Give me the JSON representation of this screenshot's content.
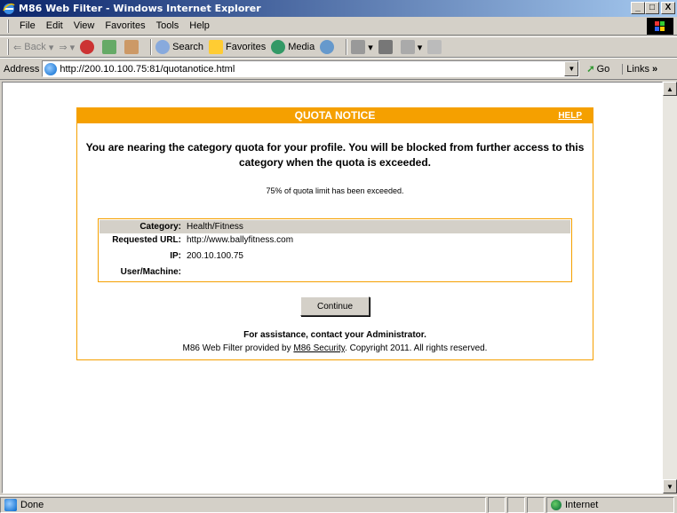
{
  "window": {
    "title": "M86 Web Filter - Windows Internet Explorer",
    "minimize": "_",
    "maximize": "□",
    "close": "X"
  },
  "menu": [
    "File",
    "Edit",
    "View",
    "Favorites",
    "Tools",
    "Help"
  ],
  "toolbar": {
    "back": "Back",
    "search": "Search",
    "favorites": "Favorites",
    "media": "Media"
  },
  "address": {
    "label": "Address",
    "url": "http://200.10.100.75:81/quotanotice.html",
    "go": "Go",
    "links": "Links"
  },
  "notice": {
    "title": "QUOTA NOTICE",
    "help": "HELP",
    "message": "You are nearing the category quota for your profile. You will be blocked from further access to this category when the quota is exceeded.",
    "percent_text": "75% of quota limit has been exceeded.",
    "details": [
      {
        "key": "Category:",
        "value": "Health/Fitness"
      },
      {
        "key": "Requested URL:",
        "value": "http://www.ballyfitness.com"
      },
      {
        "key": "IP:",
        "value": "200.10.100.75"
      },
      {
        "key": "User/Machine:",
        "value": ""
      }
    ],
    "continue_label": "Continue",
    "assistance": "For assistance, contact your Administrator.",
    "provided_prefix": "M86 Web Filter provided by ",
    "provided_link": "M86 Security",
    "provided_suffix": ". Copyright 2011. All rights reserved."
  },
  "status": {
    "text": "Done",
    "zone": "Internet"
  },
  "colors": {
    "accent": "#f5a000",
    "titlebar_start": "#0a246a",
    "titlebar_end": "#a6caf0"
  }
}
